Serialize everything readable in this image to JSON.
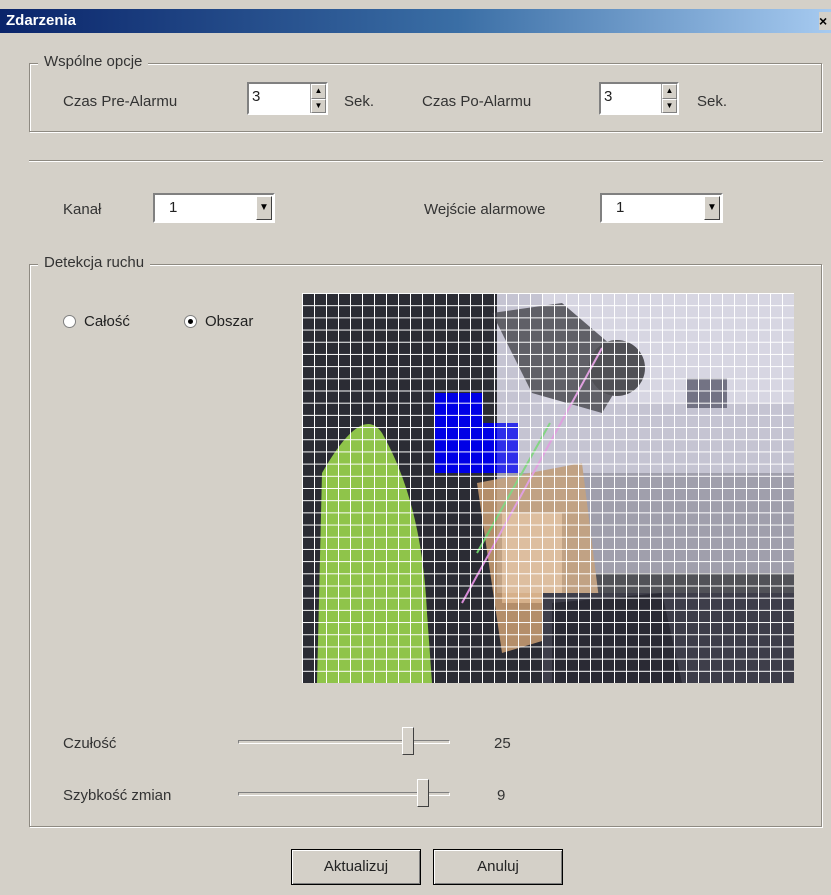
{
  "window": {
    "title": "Zdarzenia",
    "close": "×"
  },
  "common": {
    "legend": "Wspólne opcje",
    "pre_alarm_label": "Czas Pre-Alarmu",
    "pre_alarm_value": "3",
    "pre_alarm_unit": "Sek.",
    "post_alarm_label": "Czas Po-Alarmu",
    "post_alarm_value": "3",
    "post_alarm_unit": "Sek."
  },
  "channel": {
    "label": "Kanał",
    "value": "1"
  },
  "alarm_input": {
    "label": "Wejście alarmowe",
    "value": "1"
  },
  "motion": {
    "legend": "Detekcja ruchu",
    "radio_full": "Całość",
    "radio_area": "Obszar",
    "selected": "Obszar",
    "sensitivity_label": "Czułość",
    "sensitivity_value": "25",
    "speed_label": "Szybkość zmian",
    "speed_value": "9"
  },
  "buttons": {
    "update": "Aktualizuj",
    "cancel": "Anuluj"
  },
  "colors": {
    "selected_cells": "#0000e6",
    "grid_lines": "#ffffff",
    "titlebar": "#0a246a"
  }
}
